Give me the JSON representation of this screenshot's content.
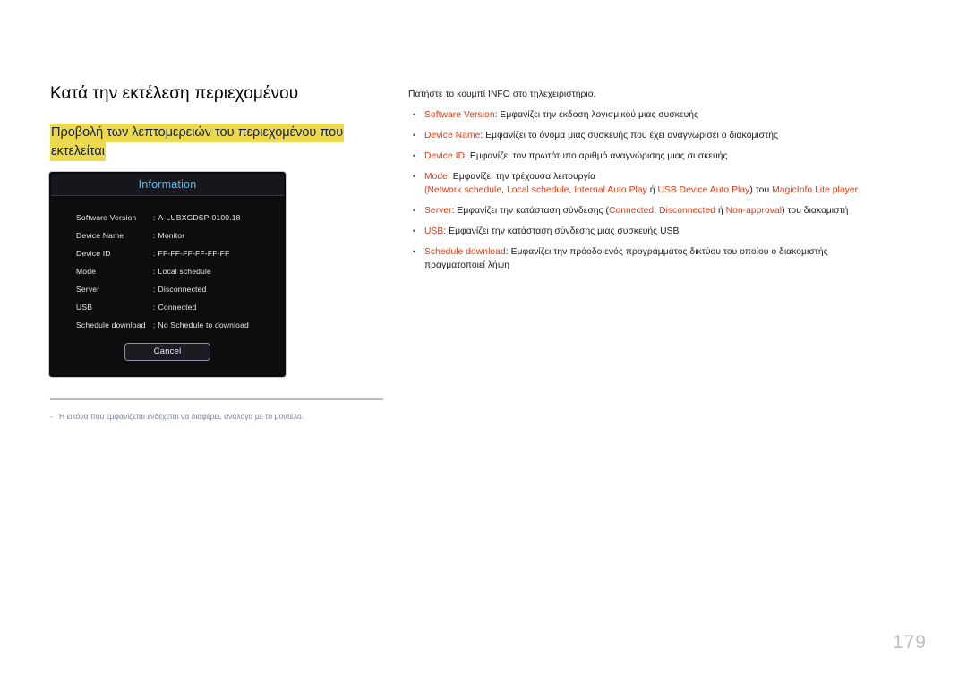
{
  "page": {
    "number": "179",
    "title": "Κατά την εκτέλεση περιεχομένου",
    "sub_heading": "Προβολή των λεπτομερειών του περιεχομένου που εκτελείται"
  },
  "colors": {
    "accent_term": "#e4380e",
    "highlight": "#ecd94e",
    "dialog_title": "#4fc3f7",
    "footnote": "#7c7f9c",
    "page_number": "#bfbfbf"
  },
  "dialog": {
    "title": "Information",
    "rows": [
      {
        "label": "Software Version",
        "colon": ":",
        "value": "A-LUBXGDSP-0100.18"
      },
      {
        "label": "Device Name",
        "colon": ":",
        "value": "Monitor"
      },
      {
        "label": "Device ID",
        "colon": ":",
        "value": "FF-FF-FF-FF-FF-FF"
      },
      {
        "label": "Mode",
        "colon": ":",
        "value": "Local schedule"
      },
      {
        "label": "Server",
        "colon": ":",
        "value": "Disconnected"
      },
      {
        "label": "USB",
        "colon": ":",
        "value": "Connected"
      },
      {
        "label": "Schedule download",
        "colon": ":",
        "value": "No Schedule to download"
      }
    ],
    "cancel_label": "Cancel"
  },
  "footnote": {
    "dash": "-",
    "text": "Η εικόνα που εμφανίζεται ενδέχεται να διαφέρει, ανάλογα με το μοντέλο."
  },
  "right": {
    "intro": "Πατήστε το κουμπί INFO στο τηλεχειριστήριο.",
    "bullet_char": "•",
    "items": [
      {
        "term": "Software Version",
        "sep": ": ",
        "desc": "Εμφανίζει την έκδοση λογισμικού μιας συσκευής"
      },
      {
        "term": "Device Name",
        "sep": ": ",
        "desc": "Εμφανίζει το όνομα μιας συσκευής που έχει αναγνωρίσει ο διακομιστής"
      },
      {
        "term": "Device ID",
        "sep": ": ",
        "desc": "Εμφανίζει τον πρωτότυπο αριθμό αναγνώρισης μιας συσκευής"
      },
      {
        "term": "Mode",
        "sep": ": ",
        "desc": "Εμφανίζει την τρέχουσα λειτουργία",
        "sub": {
          "open_paren": "(",
          "terms": [
            "Network schedule",
            "Local schedule",
            "Internal Auto Play"
          ],
          "or_word": " ή ",
          "last_term": "USB Device Auto Play",
          "close_paren": ")",
          "tail_plain": " του ",
          "tail_term": "MagicInfo Lite player"
        }
      },
      {
        "term": "Server",
        "sep": ": ",
        "desc_pre": "Εμφανίζει την κατάσταση σύνδεσης (",
        "status_terms": [
          "Connected",
          "Disconnected"
        ],
        "or_word": " ή ",
        "last_status": "Non-approval",
        "desc_post": ") του διακομιστή"
      },
      {
        "term": "USB",
        "sep": ": ",
        "desc": "Εμφανίζει την κατάσταση σύνδεσης μιας συσκευής USB"
      },
      {
        "term": "Schedule download",
        "sep": ": ",
        "desc": "Εμφανίζει την πρόοδο ενός προγράμματος δικτύου του οποίου ο διακομιστής",
        "desc_line2": "πραγματοποιεί λήψη"
      }
    ]
  }
}
